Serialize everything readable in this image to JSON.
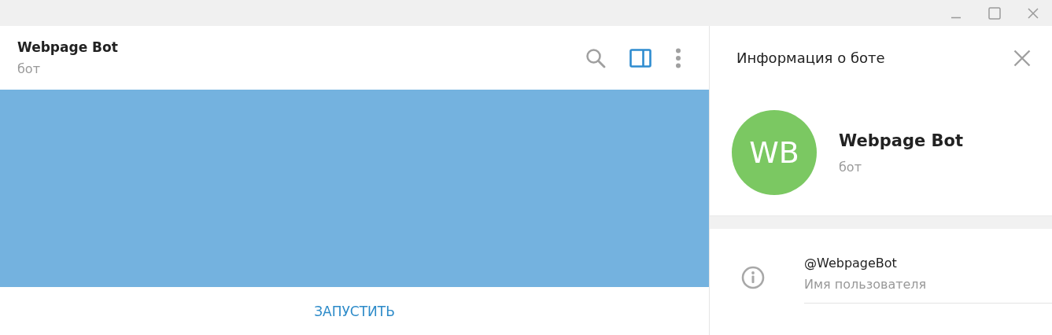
{
  "chat_header": {
    "title": "Webpage Bot",
    "subtitle": "бот",
    "info_panel_on": true
  },
  "chat": {
    "start_button": "ЗАПУСТИТЬ"
  },
  "info_panel": {
    "title": "Информация о боте",
    "profile": {
      "initials": "WB",
      "color": "#7bc862",
      "name": "Webpage Bot",
      "status": "бот"
    },
    "rows": [
      {
        "value": "@WebpageBot",
        "label": "Имя пользователя"
      }
    ]
  }
}
